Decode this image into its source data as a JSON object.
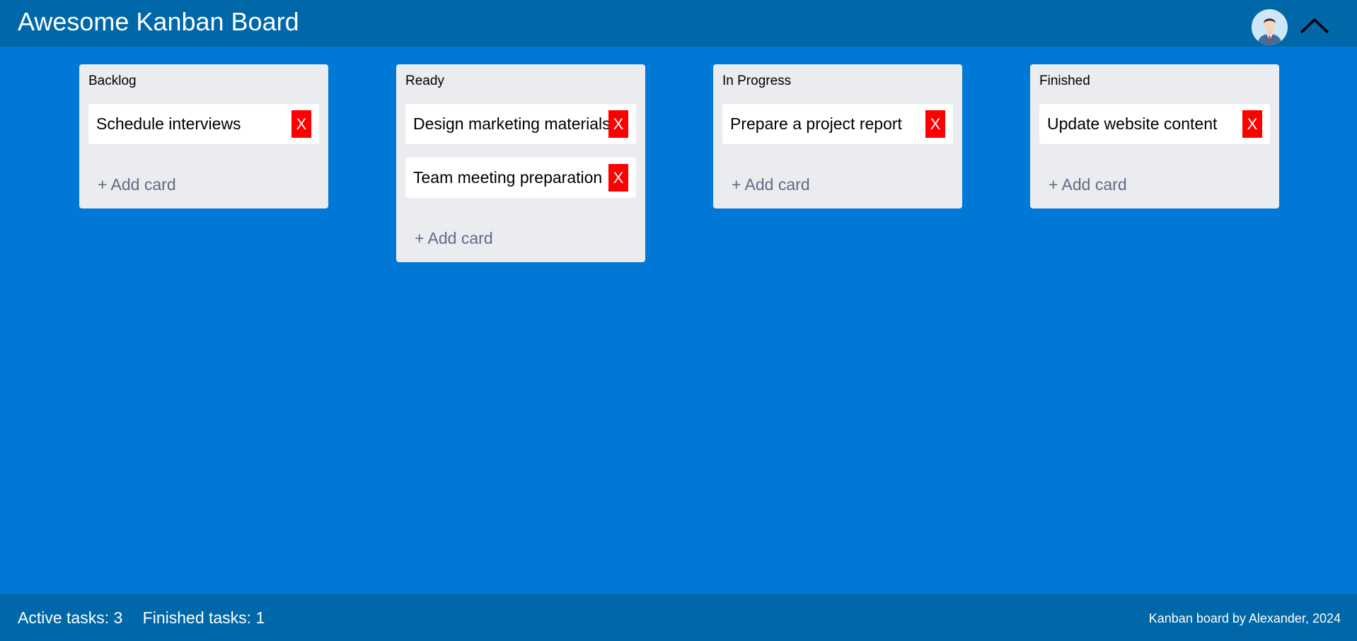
{
  "header": {
    "title": "Awesome Kanban Board",
    "avatar_icon": "user-avatar-icon",
    "menu_toggle_icon": "chevron-up-icon"
  },
  "colors": {
    "background": "#0079d6",
    "header_footer": "#0067a8",
    "column": "#ebecf0",
    "delete_button": "#ff0000",
    "add_card_text": "#5e6c84"
  },
  "columns": [
    {
      "title": "Backlog",
      "cards": [
        {
          "text": "Schedule interviews",
          "delete_label": "X"
        }
      ],
      "add_label": "+ Add card"
    },
    {
      "title": "Ready",
      "cards": [
        {
          "text": "Design marketing materials",
          "delete_label": "X"
        },
        {
          "text": "Team meeting preparation",
          "delete_label": "X"
        }
      ],
      "add_label": "+ Add card"
    },
    {
      "title": "In Progress",
      "cards": [
        {
          "text": "Prepare a project report",
          "delete_label": "X"
        }
      ],
      "add_label": "+ Add card"
    },
    {
      "title": "Finished",
      "cards": [
        {
          "text": "Update website content",
          "delete_label": "X"
        }
      ],
      "add_label": "+ Add card"
    }
  ],
  "footer": {
    "active_tasks": "Active tasks: 3",
    "finished_tasks": "Finished tasks: 1",
    "credit": "Kanban board by Alexander, 2024"
  }
}
